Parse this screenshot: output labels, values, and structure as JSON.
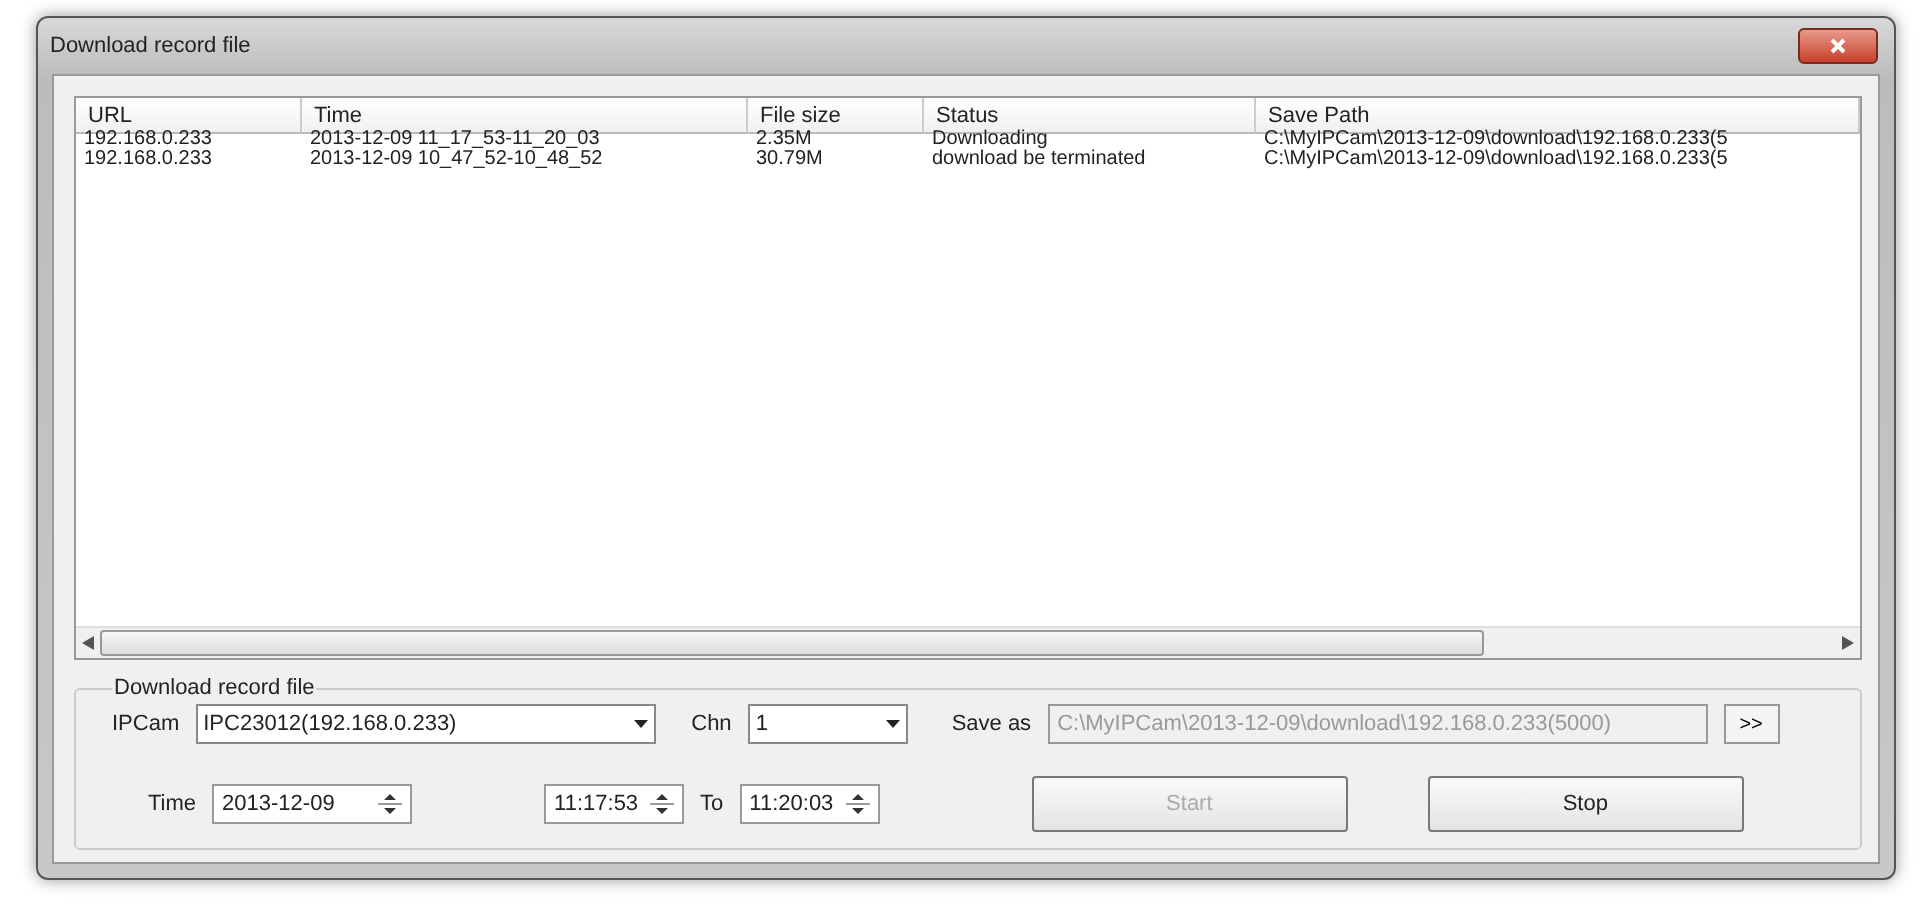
{
  "window": {
    "title": "Download record file"
  },
  "table": {
    "columns": [
      "URL",
      "Time",
      "File size",
      "Status",
      "Save Path"
    ],
    "rows": [
      [
        "192.168.0.233",
        "2013-12-09 11_17_53-11_20_03",
        "2.35M",
        "Downloading",
        "C:\\MyIPCam\\2013-12-09\\download\\192.168.0.233(5"
      ],
      [
        "192.168.0.233",
        "2013-12-09 10_47_52-10_48_52",
        "30.79M",
        "download be terminated",
        "C:\\MyIPCam\\2013-12-09\\download\\192.168.0.233(5"
      ]
    ]
  },
  "group": {
    "title": "Download record file",
    "ipcam": {
      "label": "IPCam",
      "value": "IPC23012(192.168.0.233)"
    },
    "chn": {
      "label": "Chn",
      "value": "1"
    },
    "save_as": {
      "label": "Save as",
      "value": "C:\\MyIPCam\\2013-12-09\\download\\192.168.0.233(5000)",
      "disabled": true
    },
    "browse_button": ">>",
    "time": {
      "label": "Time",
      "date": "2013-12-09",
      "from": "11:17:53",
      "to_label": "To",
      "to": "11:20:03"
    },
    "buttons": [
      {
        "label": "Start",
        "disabled": true
      },
      {
        "label": "Stop",
        "disabled": false
      }
    ]
  }
}
